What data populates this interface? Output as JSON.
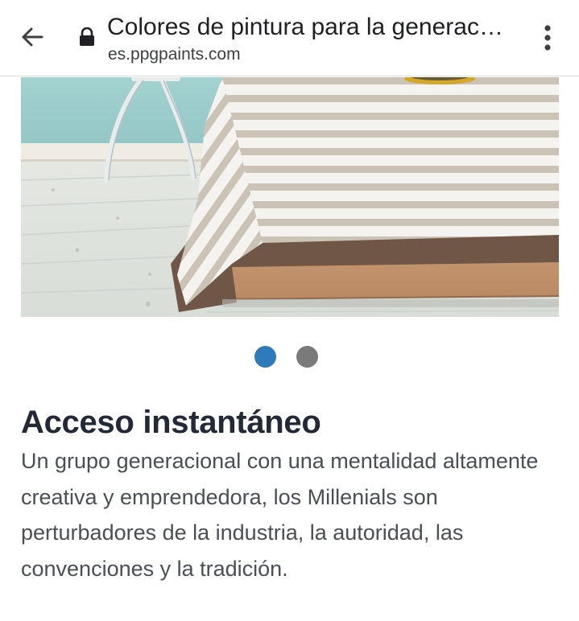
{
  "browser": {
    "tab_title": "Colores de pintura para la generac…",
    "url": "es.ppgpaints.com",
    "back_icon": "arrow-left-icon",
    "lock_icon": "lock-icon",
    "menu_icon": "more-vertical-icon"
  },
  "carousel": {
    "slides": [
      {
        "active": true
      },
      {
        "active": false
      }
    ],
    "active_color": "#2f7ab8",
    "inactive_color": "#7a7a7a"
  },
  "article": {
    "heading": "Acceso instantáneo",
    "body": "Un grupo generacional con una mentalidad altamente creativa y emprendedora, los Millenials son perturbadores de la industria, la autoridad, las convenciones y la tradición."
  }
}
